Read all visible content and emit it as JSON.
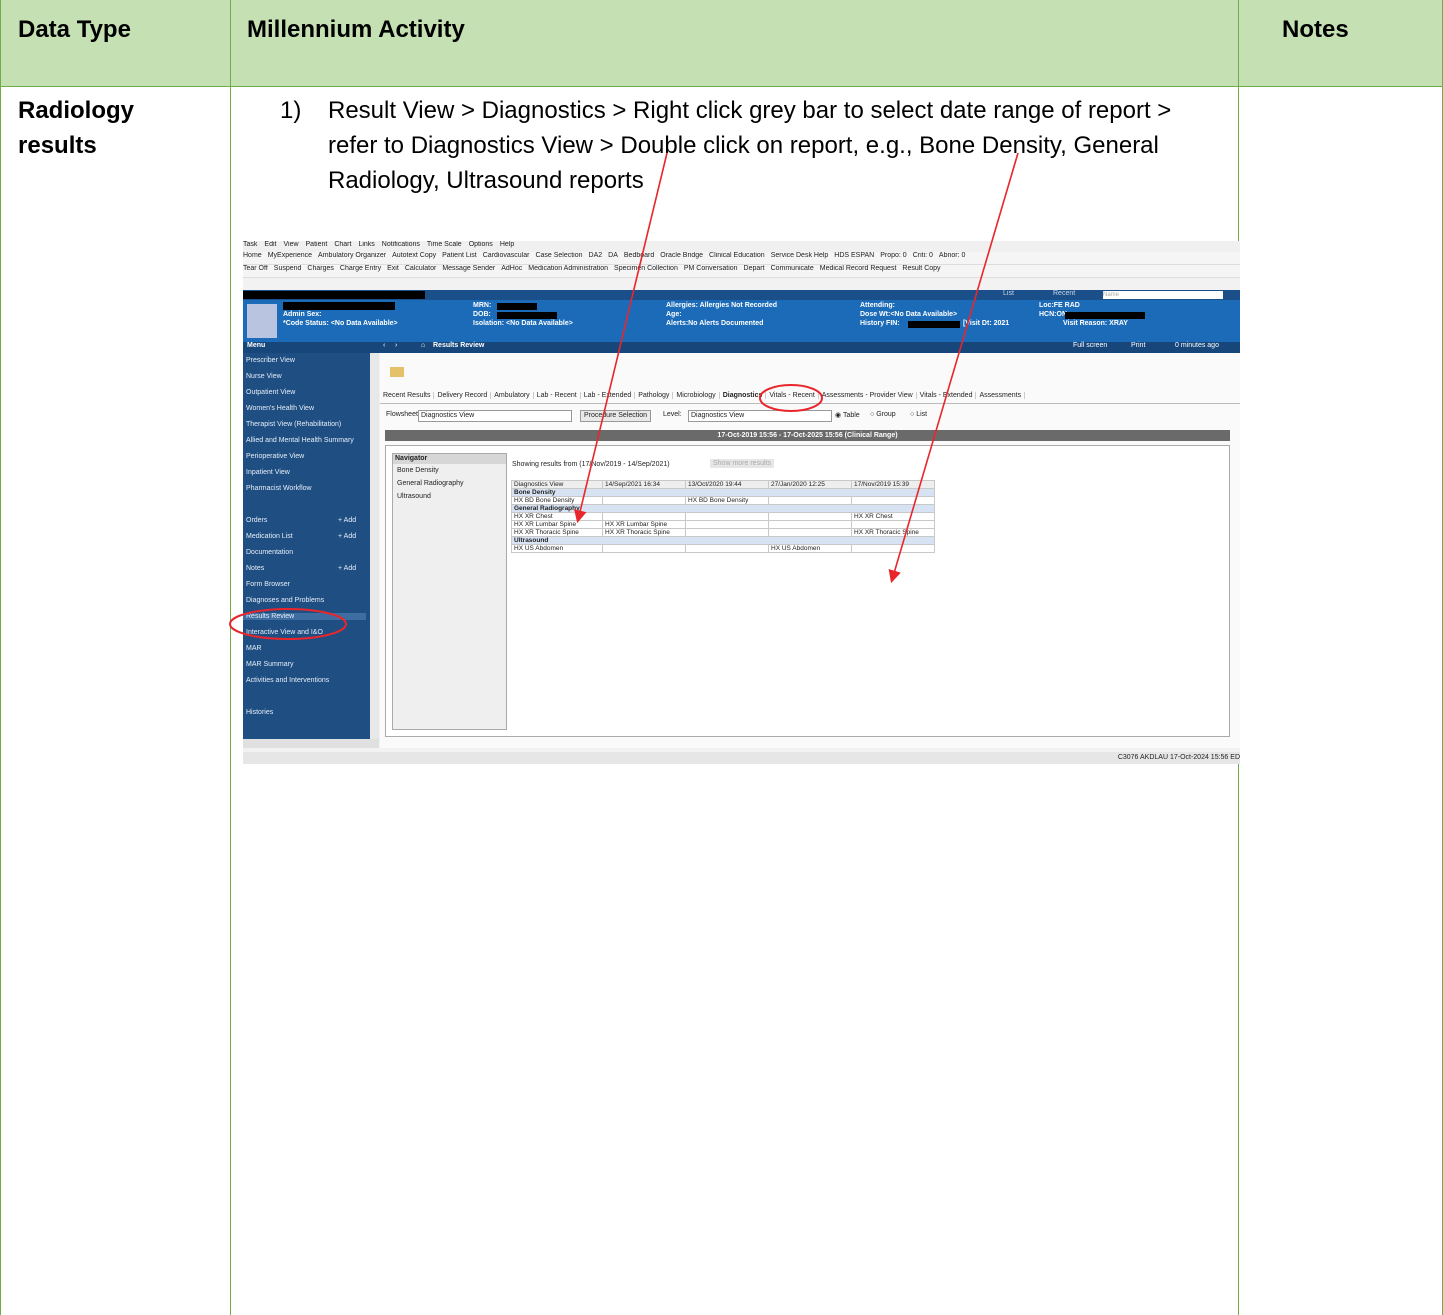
{
  "table": {
    "headers": {
      "data_type": "Data Type",
      "activity": "Millennium Activity",
      "notes": "Notes"
    },
    "row": {
      "data_type": "Radiology results",
      "step_number": "1)",
      "step_text": "Result View > Diagnostics > Right click grey bar to select date range of report > refer to Diagnostics View > Double click on report, e.g., Bone Density, General Radiology, Ultrasound reports"
    }
  },
  "screenshot": {
    "menu": [
      "Task",
      "Edit",
      "View",
      "Patient",
      "Chart",
      "Links",
      "Notifications",
      "Time Scale",
      "Options",
      "Help"
    ],
    "toolbar1": [
      "Home",
      "MyExperience",
      "Ambulatory Organizer",
      "Autotext Copy",
      "Patient List",
      "Cardiovascular",
      "Case Selection",
      "DA2",
      "DA",
      "Bedboard",
      "Oracle Bridge",
      "Clinical Education",
      "Service Desk Help",
      "HDS ESPAN",
      "Propo: 0",
      "Criti: 0",
      "Abnor: 0"
    ],
    "toolbar2": [
      "Tear Off",
      "Suspend",
      "Charges",
      "Charge Entry",
      "Exit",
      "Calculator",
      "Message Sender",
      "AdHoc",
      "Medication Administration",
      "Specimen Collection",
      "PM Conversation",
      "Depart",
      "Communicate",
      "Medical Record Request",
      "Result Copy"
    ],
    "list_label": "List",
    "recent_label": "Recent",
    "name_placeholder": "Name",
    "banner": {
      "admin_sex": "Admin Sex:",
      "code_status": "*Code Status: <No Data Available>",
      "mrn": "MRN:",
      "dob": "DOB:",
      "isolation": "Isolation: <No Data Available>",
      "allergies": "Allergies: Allergies Not Recorded",
      "age": "Age:",
      "alerts": "Alerts:No Alerts Documented",
      "attending": "Attending:",
      "dose_wt": "Dose Wt:<No Data Available>",
      "history_fin": "History FIN:",
      "visit_dt": "[Visit Dt: 2021",
      "loc": "Loc:FE RAD",
      "hcn": "HCN:ON",
      "visit_reason": "Visit Reason: XRAY"
    },
    "nav": {
      "menu": "Menu",
      "title": "Results Review",
      "full_screen": "Full screen",
      "print": "Print",
      "minutes_ago": "0 minutes ago"
    },
    "sidebar_items": [
      "Prescriber View",
      "Nurse View",
      "Outpatient View",
      "Women's Health View",
      "Therapist View (Rehabilitation)",
      "Allied and Mental Health Summary",
      "Perioperative View",
      "Inpatient View",
      "Pharmacist Workflow",
      "",
      "Orders",
      "Medication List",
      "Documentation",
      "Notes",
      "Form Browser",
      "Diagnoses and Problems",
      "Results Review",
      "Interactive View and I&O",
      "MAR",
      "MAR Summary",
      "Activities and Interventions",
      "",
      "Histories"
    ],
    "add_label": "+ Add",
    "tabs": [
      "Recent Results",
      "Delivery Record",
      "Ambulatory",
      "Lab - Recent",
      "Lab - Extended",
      "Pathology",
      "Microbiology",
      "Diagnostics",
      "Vitals - Recent",
      "Assessments - Provider View",
      "Vitals - Extended",
      "Assessments"
    ],
    "active_tab": "Diagnostics",
    "flowsheet_label": "Flowsheet:",
    "flowsheet_value": "Diagnostics View",
    "procedure_button": "Procedure Selection",
    "level_label": "Level:",
    "level_value": "Diagnostics View",
    "radio_options": [
      "Table",
      "Group",
      "List"
    ],
    "range_bar": "17-Oct-2019 15:56 - 17-Oct-2025 15:56 (Clinical Range)",
    "navigator_title": "Navigator",
    "navigator_items": [
      "Bone Density",
      "General Radiography",
      "Ultrasound"
    ],
    "showing_text": "Showing results from (17/Nov/2019 - 14/Sep/2021)",
    "show_more": "Show more results",
    "grid_headers": [
      "Diagnostics View",
      "14/Sep/2021 16:34",
      "13/Oct/2020 19:44",
      "27/Jan/2020 12:25",
      "17/Nov/2019 15:39"
    ],
    "grid_rows": [
      {
        "section": "Bone Density"
      },
      {
        "label": "HX BD Bone Density",
        "cells": [
          "",
          "HX BD Bone Density",
          "",
          ""
        ]
      },
      {
        "section": "General Radiography"
      },
      {
        "label": "HX XR Chest",
        "cells": [
          "",
          "",
          "",
          "HX XR Chest"
        ]
      },
      {
        "label": "HX XR Lumbar Spine",
        "cells": [
          "HX XR Lumbar Spine",
          "",
          "",
          ""
        ]
      },
      {
        "label": "HX XR Thoracic Spine",
        "cells": [
          "HX XR Thoracic Spine",
          "",
          "",
          "HX XR Thoracic Spine"
        ]
      },
      {
        "section": "Ultrasound"
      },
      {
        "label": "HX US Abdomen",
        "cells": [
          "",
          "",
          "HX US Abdomen",
          ""
        ]
      }
    ],
    "status_bar": "C3076  AKDLAU  17-Oct-2024  15:56 ED"
  },
  "colors": {
    "header_bg": "#c5e0b3",
    "border": "#70ad47",
    "annotation": "#e8262b"
  }
}
